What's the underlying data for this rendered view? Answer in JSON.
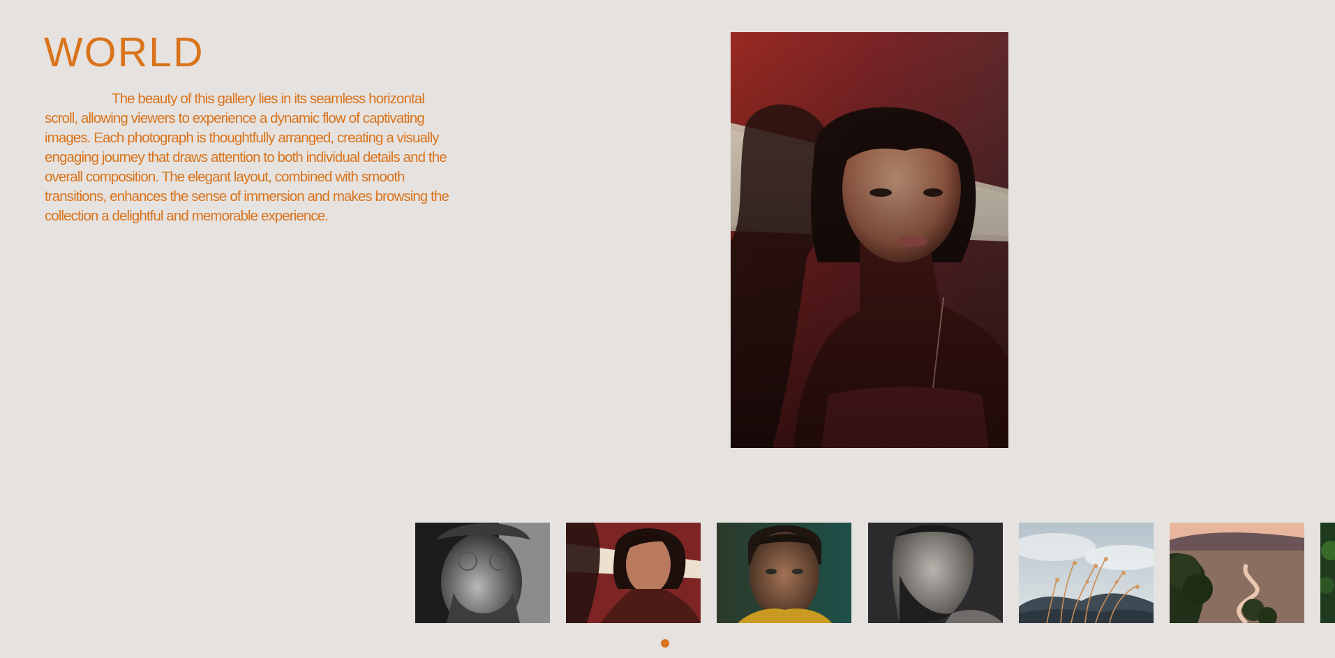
{
  "gallery": {
    "title": "WORLD",
    "description": "The beauty of this gallery lies in its seamless horizontal scroll, allowing viewers to experience a dynamic flow of captivating images. Each photograph is thoughtfully arranged, creating a visually engaging journey that draws attention to both individual details and the overall composition. The elegant layout, combined with smooth transitions, enhances the sense of immersion and makes browsing the collection a delightful and memorable experience."
  },
  "theme": {
    "accent": "#d9741d",
    "background": "#e6e2df"
  },
  "featured_image": {
    "subject": "woman-portrait-red-light"
  },
  "thumbnails": [
    {
      "subject": "bearded-man-glasses-bw"
    },
    {
      "subject": "woman-portrait-red-light"
    },
    {
      "subject": "young-man-portrait-teal"
    },
    {
      "subject": "bearded-man-profile-dark"
    },
    {
      "subject": "dry-grass-mountains-sky"
    },
    {
      "subject": "river-valley-landscape"
    },
    {
      "subject": "forest-partial"
    }
  ],
  "pager": {
    "active_index": 0
  }
}
